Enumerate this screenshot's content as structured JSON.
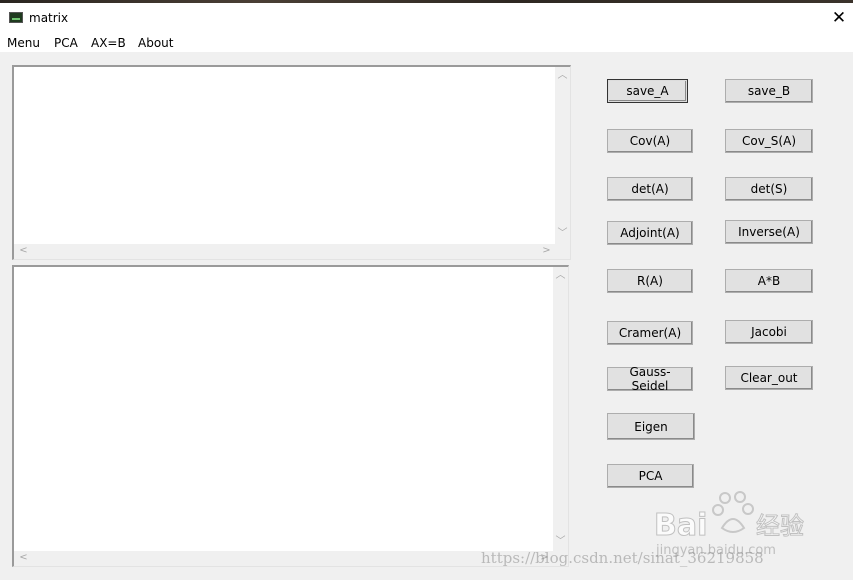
{
  "window": {
    "title": "matrix",
    "close_glyph": "✕"
  },
  "menu": {
    "items": [
      "Menu",
      "PCA",
      "AX=B",
      "About"
    ]
  },
  "textareas": {
    "input": "",
    "output": ""
  },
  "buttons": {
    "save_a": "save_A",
    "save_b": "save_B",
    "cov_a": "Cov(A)",
    "cov_s_a": "Cov_S(A)",
    "det_a": "det(A)",
    "det_s": "det(S)",
    "adjoint_a": "Adjoint(A)",
    "inverse_a": "Inverse(A)",
    "r_a": "R(A)",
    "a_times_b": "A*B",
    "cramer_a": "Cramer(A)",
    "jacobi": "Jacobi",
    "gauss_seidel": "Gauss-Seidel",
    "clear_out": "Clear_out",
    "eigen": "Eigen",
    "pca": "PCA"
  },
  "watermark": {
    "url": "https://blog.csdn.net/sinat_36219858",
    "sub": "jingyan.baidu.com",
    "logo_text": "Bai",
    "logo_cn": "经验"
  },
  "icons": {
    "app": "matrix-app-icon",
    "close": "close-icon",
    "scroll_up": "scroll-up-arrow-icon",
    "scroll_down": "scroll-down-arrow-icon",
    "scroll_left": "scroll-left-arrow-icon",
    "scroll_right": "scroll-right-arrow-icon"
  }
}
